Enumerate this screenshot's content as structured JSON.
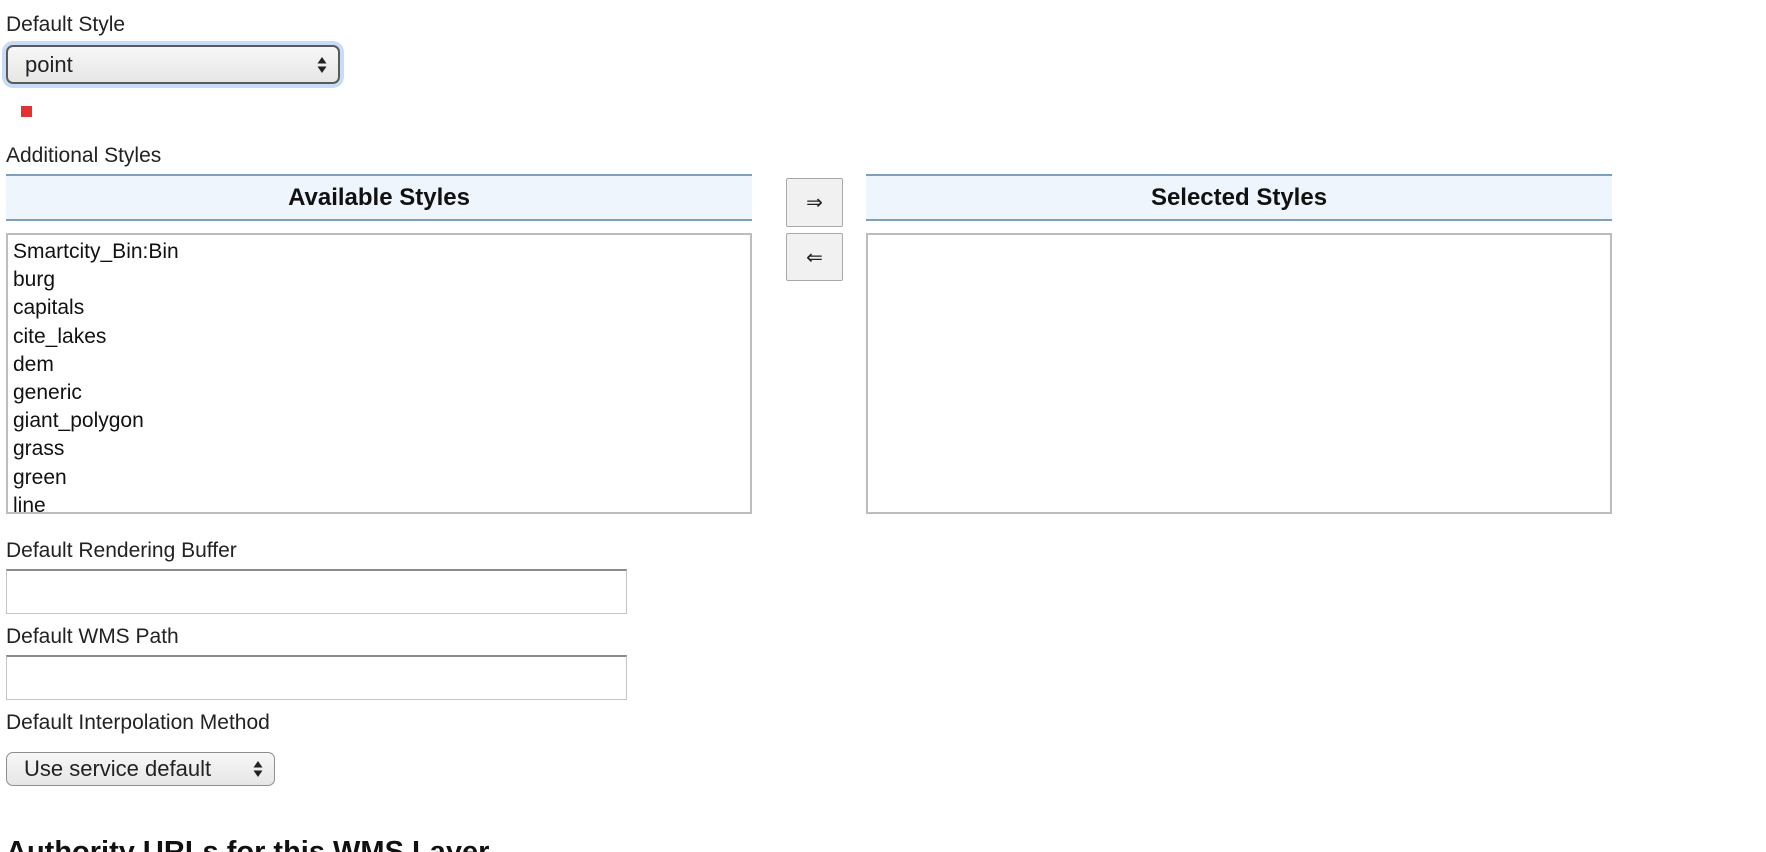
{
  "default_style": {
    "label": "Default Style",
    "selected": "point"
  },
  "additional_styles": {
    "label": "Additional Styles",
    "available_header": "Available Styles",
    "selected_header": "Selected Styles",
    "available_items": [
      "Smartcity_Bin:Bin",
      "burg",
      "capitals",
      "cite_lakes",
      "dem",
      "generic",
      "giant_polygon",
      "grass",
      "green",
      "line"
    ],
    "selected_items": [],
    "move_right_label": "⇒",
    "move_left_label": "⇐"
  },
  "rendering_buffer": {
    "label": "Default Rendering Buffer",
    "value": ""
  },
  "wms_path": {
    "label": "Default WMS Path",
    "value": ""
  },
  "interpolation": {
    "label": "Default Interpolation Method",
    "selected": "Use service default"
  },
  "next_section": {
    "heading": "Authority URLs for this WMS Layer"
  },
  "colors": {
    "error_marker": "#e23232",
    "panel_header_bg": "#eef5fd",
    "panel_header_border": "#7ea0bf",
    "focus_ring": "#c9dcf5"
  }
}
